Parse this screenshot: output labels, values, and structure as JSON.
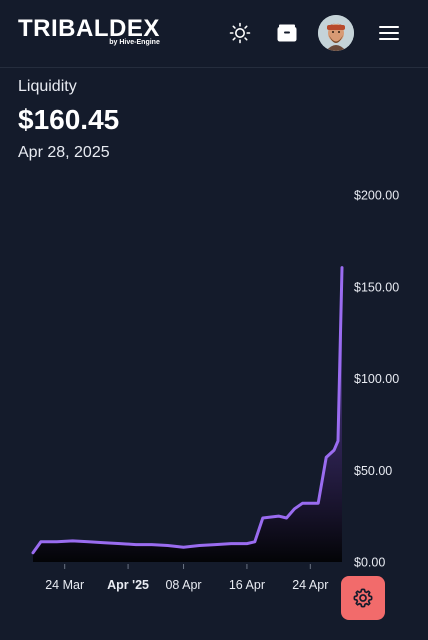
{
  "header": {
    "logo_text": "TRIBALDEX",
    "logo_sub": "by Hive-Engine",
    "icons": [
      "sun-icon",
      "wallet-icon",
      "avatar",
      "menu-icon"
    ]
  },
  "summary": {
    "label": "Liquidity",
    "value": "$160.45",
    "date": "Apr 28, 2025"
  },
  "colors": {
    "background": "#141b2b",
    "line": "#9a6cf0",
    "settings_button": "#f26b6b"
  },
  "chart_data": {
    "type": "area",
    "title": "",
    "xlabel": "",
    "ylabel": "",
    "ylim": [
      0,
      200
    ],
    "y_ticks": [
      "$200.00",
      "$150.00",
      "$100.00",
      "$50.00",
      "$0.00"
    ],
    "y_tick_values": [
      200,
      150,
      100,
      50,
      0
    ],
    "x_ticks": [
      "24 Mar",
      "Apr '25",
      "08 Apr",
      "16 Apr",
      "24 Apr"
    ],
    "x_tick_dates": [
      "2025-03-24",
      "2025-04-01",
      "2025-04-08",
      "2025-04-16",
      "2025-04-24"
    ],
    "x_tick_bold": [
      false,
      true,
      false,
      false,
      false
    ],
    "x_range": [
      "2025-03-20",
      "2025-04-28"
    ],
    "series": [
      {
        "values": [
          {
            "x": "2025-03-20",
            "y": 5
          },
          {
            "x": "2025-03-21",
            "y": 11
          },
          {
            "x": "2025-03-23",
            "y": 11
          },
          {
            "x": "2025-03-25",
            "y": 11.5
          },
          {
            "x": "2025-03-27",
            "y": 11
          },
          {
            "x": "2025-03-29",
            "y": 10.5
          },
          {
            "x": "2025-03-31",
            "y": 10
          },
          {
            "x": "2025-04-02",
            "y": 9.5
          },
          {
            "x": "2025-04-04",
            "y": 9.5
          },
          {
            "x": "2025-04-06",
            "y": 9
          },
          {
            "x": "2025-04-08",
            "y": 8
          },
          {
            "x": "2025-04-10",
            "y": 9
          },
          {
            "x": "2025-04-12",
            "y": 9.5
          },
          {
            "x": "2025-04-14",
            "y": 10
          },
          {
            "x": "2025-04-16",
            "y": 10
          },
          {
            "x": "2025-04-17",
            "y": 11
          },
          {
            "x": "2025-04-18",
            "y": 24
          },
          {
            "x": "2025-04-20",
            "y": 25
          },
          {
            "x": "2025-04-21",
            "y": 24
          },
          {
            "x": "2025-04-22",
            "y": 29
          },
          {
            "x": "2025-04-23",
            "y": 32
          },
          {
            "x": "2025-04-25",
            "y": 32
          },
          {
            "x": "2025-04-26",
            "y": 57
          },
          {
            "x": "2025-04-27",
            "y": 61
          },
          {
            "x": "2025-04-27.5",
            "y": 66
          },
          {
            "x": "2025-04-28",
            "y": 160.45
          }
        ]
      }
    ]
  }
}
